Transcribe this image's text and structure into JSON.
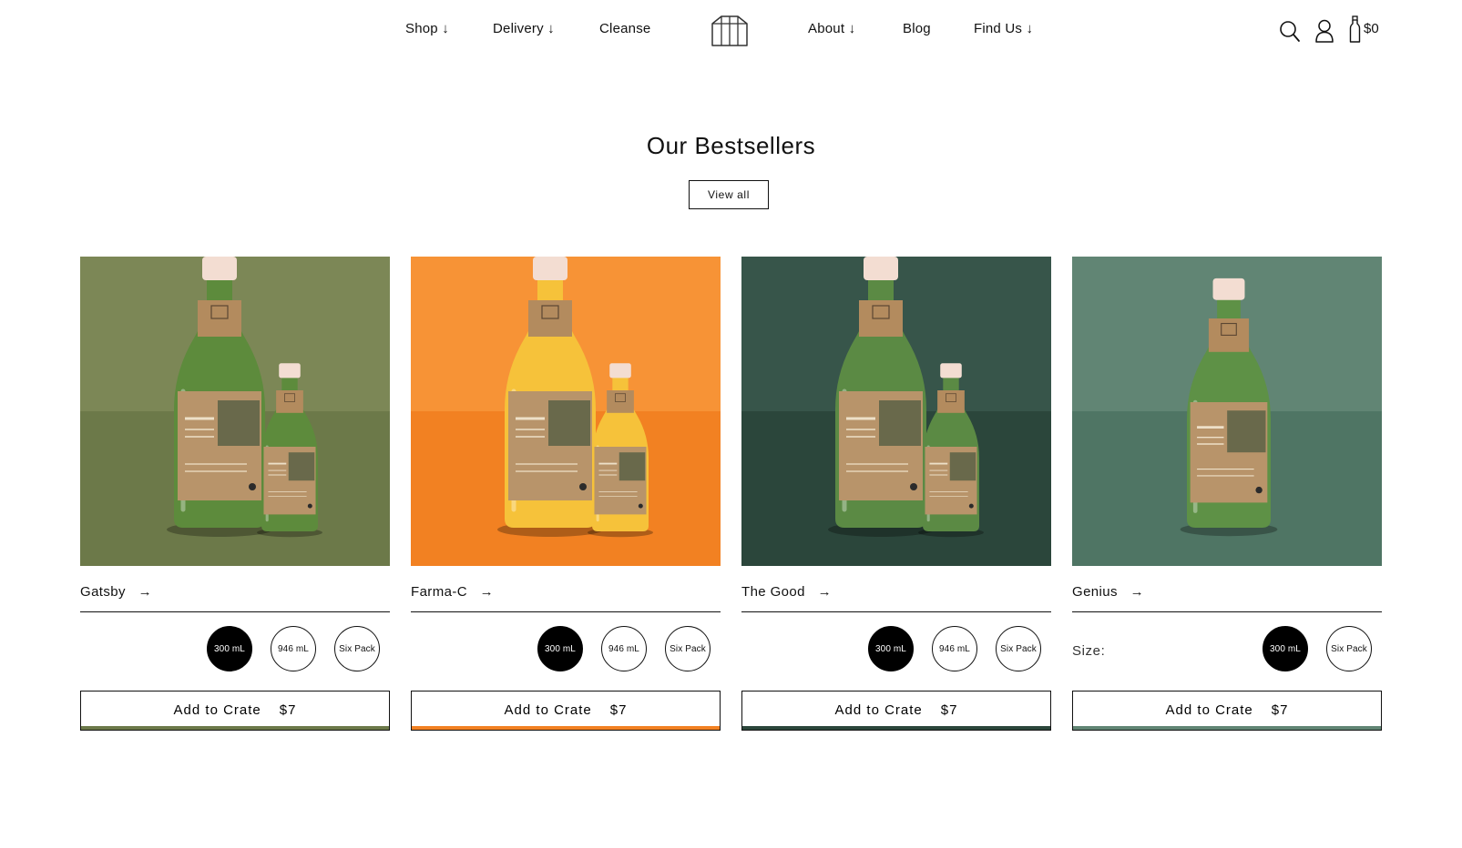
{
  "nav": {
    "shop": "Shop ↓",
    "delivery": "Delivery ↓",
    "cleanse": "Cleanse",
    "about": "About ↓",
    "blog": "Blog",
    "find_us": "Find Us ↓"
  },
  "header": {
    "logo_icon": "greenhouse-logo-icon",
    "icons": [
      "search-icon",
      "account-icon",
      "bottle-cart-icon"
    ],
    "cart_total": "$0"
  },
  "section": {
    "title": "Our Bestsellers",
    "view_all": "View all"
  },
  "products": [
    {
      "name": "Gatsby",
      "arrow": "→",
      "sizes": [
        "300 mL",
        "946 mL",
        "Six Pack"
      ],
      "selected_size": "300 mL",
      "add_label": "Add to Crate",
      "price": "$7",
      "bg_top": "#7c8756",
      "bg_bottom": "#6c7949",
      "strip": "#6c7949",
      "juice": "#5d8b3c",
      "bottles": 2
    },
    {
      "name": "Farma-C",
      "arrow": "→",
      "sizes": [
        "300 mL",
        "946 mL",
        "Six Pack"
      ],
      "selected_size": "300 mL",
      "add_label": "Add to Crate",
      "price": "$7",
      "bg_top": "#f79336",
      "bg_bottom": "#f28122",
      "strip": "#f28122",
      "juice": "#f6c23a",
      "bottles": 2
    },
    {
      "name": "The Good",
      "arrow": "→",
      "sizes": [
        "300 mL",
        "946 mL",
        "Six Pack"
      ],
      "selected_size": "300 mL",
      "add_label": "Add to Crate",
      "price": "$7",
      "bg_top": "#37554a",
      "bg_bottom": "#2b463b",
      "strip": "#2b463b",
      "juice": "#5b8a44",
      "bottles": 2
    },
    {
      "name": "Genius",
      "arrow": "→",
      "size_label": "Size:",
      "sizes": [
        "300 mL",
        "Six Pack"
      ],
      "selected_size": "300 mL",
      "add_label": "Add to Crate",
      "price": "$7",
      "bg_top": "#618574",
      "bg_bottom": "#4f7564",
      "strip": "#618574",
      "juice": "#5e9146",
      "bottles": 1
    }
  ]
}
